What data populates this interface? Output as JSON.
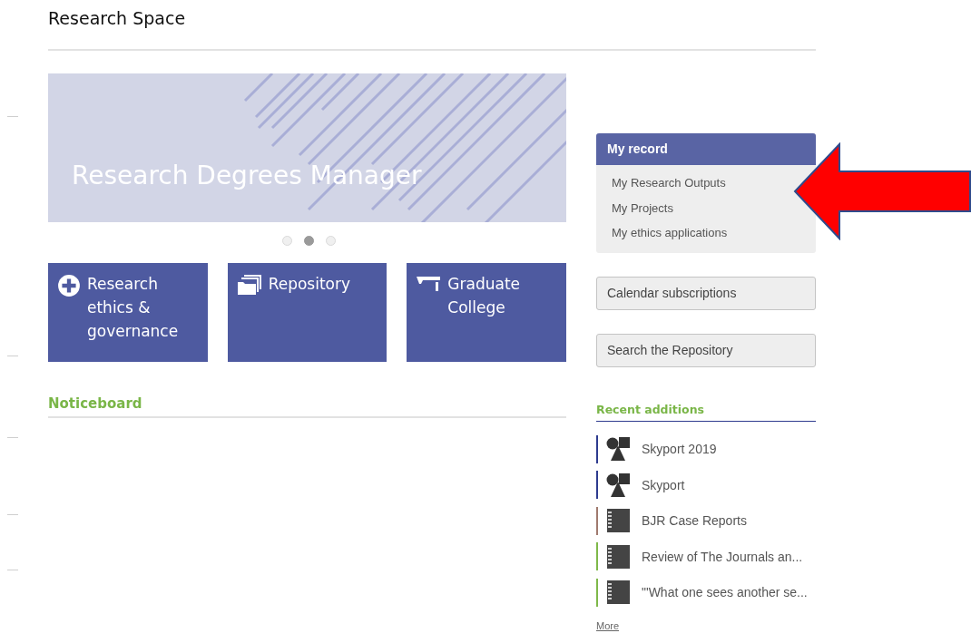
{
  "page": {
    "title": "Research Space"
  },
  "banner": {
    "title": "Research Degrees Manager"
  },
  "carousel_dots": [
    {
      "selected": false
    },
    {
      "selected": true
    },
    {
      "selected": false
    }
  ],
  "tiles": [
    {
      "kind": "ethics",
      "label": "Research ethics & governance"
    },
    {
      "kind": "repository",
      "label": "Repository"
    },
    {
      "kind": "college",
      "label": "Graduate College"
    }
  ],
  "noticeboard": {
    "heading": "Noticeboard"
  },
  "my_record": {
    "title": "My record",
    "links": [
      "My Research Outputs",
      "My Projects",
      "My ethics applications"
    ]
  },
  "sidebar_buttons": [
    "Calendar subscriptions",
    "Search the Repository"
  ],
  "recent_additions": {
    "heading": "Recent additions",
    "items": [
      {
        "kind": "dataset",
        "color": "#2e3b8f",
        "title": "Skyport 2019"
      },
      {
        "kind": "dataset",
        "color": "#2e3b8f",
        "title": "Skyport"
      },
      {
        "kind": "journal",
        "color": "#a07a6e",
        "title": "BJR Case Reports"
      },
      {
        "kind": "journal",
        "color": "#7fb94a",
        "title": "Review of The Journals an..."
      },
      {
        "kind": "journal",
        "color": "#7fb94a",
        "title": "\"'What one sees another se..."
      }
    ],
    "more": "More"
  }
}
